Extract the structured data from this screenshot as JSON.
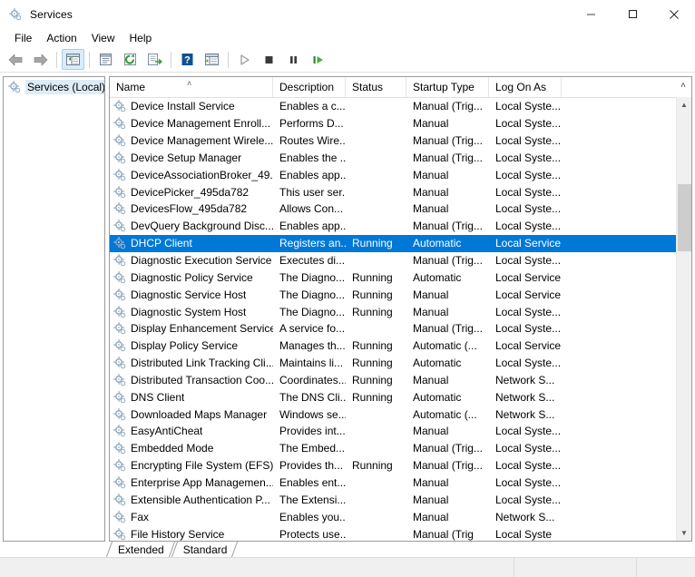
{
  "window": {
    "title": "Services",
    "icon": "services-gear-icon",
    "minimize_label": "Minimize",
    "maximize_label": "Maximize",
    "close_label": "Close"
  },
  "menubar": {
    "items": [
      {
        "label": "File",
        "name": "menu-file"
      },
      {
        "label": "Action",
        "name": "menu-action"
      },
      {
        "label": "View",
        "name": "menu-view"
      },
      {
        "label": "Help",
        "name": "menu-help"
      }
    ]
  },
  "toolbar": {
    "buttons": [
      {
        "icon": "back-arrow-icon",
        "label": "Back"
      },
      {
        "icon": "forward-arrow-icon",
        "label": "Forward"
      },
      {
        "icon": "show-hide-console-tree-icon",
        "label": "Show/Hide Console Tree"
      },
      {
        "icon": "properties-icon",
        "label": "Properties"
      },
      {
        "icon": "refresh-icon",
        "label": "Refresh"
      },
      {
        "icon": "export-list-icon",
        "label": "Export List"
      },
      {
        "icon": "help-icon",
        "label": "Help"
      },
      {
        "icon": "show-action-pane-icon",
        "label": "Show/Hide Action Pane"
      },
      {
        "icon": "start-service-icon",
        "label": "Start Service"
      },
      {
        "icon": "stop-service-icon",
        "label": "Stop Service"
      },
      {
        "icon": "pause-service-icon",
        "label": "Pause Service"
      },
      {
        "icon": "restart-service-icon",
        "label": "Restart Service"
      }
    ]
  },
  "tree": {
    "nodes": [
      {
        "label": "Services (Local)",
        "icon": "services-gear-icon",
        "selected": true
      }
    ]
  },
  "list": {
    "columns": [
      {
        "key": "name",
        "label": "Name",
        "sorted": "asc"
      },
      {
        "key": "description",
        "label": "Description"
      },
      {
        "key": "status",
        "label": "Status"
      },
      {
        "key": "startup",
        "label": "Startup Type"
      },
      {
        "key": "logon",
        "label": "Log On As"
      }
    ],
    "sort_arrow": "˄",
    "header_chevron": "˄",
    "rows": [
      {
        "name": "Device Install Service",
        "description": "Enables a c...",
        "status": "",
        "startup": "Manual (Trig...",
        "logon": "Local Syste...",
        "selected": false
      },
      {
        "name": "Device Management Enroll...",
        "description": "Performs D...",
        "status": "",
        "startup": "Manual",
        "logon": "Local Syste...",
        "selected": false
      },
      {
        "name": "Device Management Wirele...",
        "description": "Routes Wire...",
        "status": "",
        "startup": "Manual (Trig...",
        "logon": "Local Syste...",
        "selected": false
      },
      {
        "name": "Device Setup Manager",
        "description": "Enables the ...",
        "status": "",
        "startup": "Manual (Trig...",
        "logon": "Local Syste...",
        "selected": false
      },
      {
        "name": "DeviceAssociationBroker_49...",
        "description": "Enables app...",
        "status": "",
        "startup": "Manual",
        "logon": "Local Syste...",
        "selected": false
      },
      {
        "name": "DevicePicker_495da782",
        "description": "This user ser...",
        "status": "",
        "startup": "Manual",
        "logon": "Local Syste...",
        "selected": false
      },
      {
        "name": "DevicesFlow_495da782",
        "description": "Allows Con...",
        "status": "",
        "startup": "Manual",
        "logon": "Local Syste...",
        "selected": false
      },
      {
        "name": "DevQuery Background Disc...",
        "description": "Enables app...",
        "status": "",
        "startup": "Manual (Trig...",
        "logon": "Local Syste...",
        "selected": false
      },
      {
        "name": "DHCP Client",
        "description": "Registers an...",
        "status": "Running",
        "startup": "Automatic",
        "logon": "Local Service",
        "selected": true
      },
      {
        "name": "Diagnostic Execution Service",
        "description": "Executes di...",
        "status": "",
        "startup": "Manual (Trig...",
        "logon": "Local Syste...",
        "selected": false
      },
      {
        "name": "Diagnostic Policy Service",
        "description": "The Diagno...",
        "status": "Running",
        "startup": "Automatic",
        "logon": "Local Service",
        "selected": false
      },
      {
        "name": "Diagnostic Service Host",
        "description": "The Diagno...",
        "status": "Running",
        "startup": "Manual",
        "logon": "Local Service",
        "selected": false
      },
      {
        "name": "Diagnostic System Host",
        "description": "The Diagno...",
        "status": "Running",
        "startup": "Manual",
        "logon": "Local Syste...",
        "selected": false
      },
      {
        "name": "Display Enhancement Service",
        "description": "A service fo...",
        "status": "",
        "startup": "Manual (Trig...",
        "logon": "Local Syste...",
        "selected": false
      },
      {
        "name": "Display Policy Service",
        "description": "Manages th...",
        "status": "Running",
        "startup": "Automatic (...",
        "logon": "Local Service",
        "selected": false
      },
      {
        "name": "Distributed Link Tracking Cli...",
        "description": "Maintains li...",
        "status": "Running",
        "startup": "Automatic",
        "logon": "Local Syste...",
        "selected": false
      },
      {
        "name": "Distributed Transaction Coo...",
        "description": "Coordinates...",
        "status": "Running",
        "startup": "Manual",
        "logon": "Network S...",
        "selected": false
      },
      {
        "name": "DNS Client",
        "description": "The DNS Cli...",
        "status": "Running",
        "startup": "Automatic",
        "logon": "Network S...",
        "selected": false
      },
      {
        "name": "Downloaded Maps Manager",
        "description": "Windows se...",
        "status": "",
        "startup": "Automatic (...",
        "logon": "Network S...",
        "selected": false
      },
      {
        "name": "EasyAntiCheat",
        "description": "Provides int...",
        "status": "",
        "startup": "Manual",
        "logon": "Local Syste...",
        "selected": false
      },
      {
        "name": "Embedded Mode",
        "description": "The Embed...",
        "status": "",
        "startup": "Manual (Trig...",
        "logon": "Local Syste...",
        "selected": false
      },
      {
        "name": "Encrypting File System (EFS)",
        "description": "Provides th...",
        "status": "Running",
        "startup": "Manual (Trig...",
        "logon": "Local Syste...",
        "selected": false
      },
      {
        "name": "Enterprise App Managemen...",
        "description": "Enables ent...",
        "status": "",
        "startup": "Manual",
        "logon": "Local Syste...",
        "selected": false
      },
      {
        "name": "Extensible Authentication P...",
        "description": "The Extensi...",
        "status": "",
        "startup": "Manual",
        "logon": "Local Syste...",
        "selected": false
      },
      {
        "name": "Fax",
        "description": "Enables you...",
        "status": "",
        "startup": "Manual",
        "logon": "Network S...",
        "selected": false
      },
      {
        "name": "File History Service",
        "description": "Protects use...",
        "status": "",
        "startup": "Manual (Trig",
        "logon": "Local Syste",
        "selected": false
      }
    ]
  },
  "tabs": [
    {
      "label": "Extended",
      "name": "tab-extended",
      "active": false
    },
    {
      "label": "Standard",
      "name": "tab-standard",
      "active": true
    }
  ],
  "colors": {
    "selection": "#0078d7",
    "selection_text": "#ffffff",
    "window_bg": "#ffffff",
    "statusbar_bg": "#f0f0f0",
    "toolbar_active": "#d9ecfb",
    "scrollbar_thumb": "#cdcdcd",
    "green_accent": "#4caf3f"
  }
}
